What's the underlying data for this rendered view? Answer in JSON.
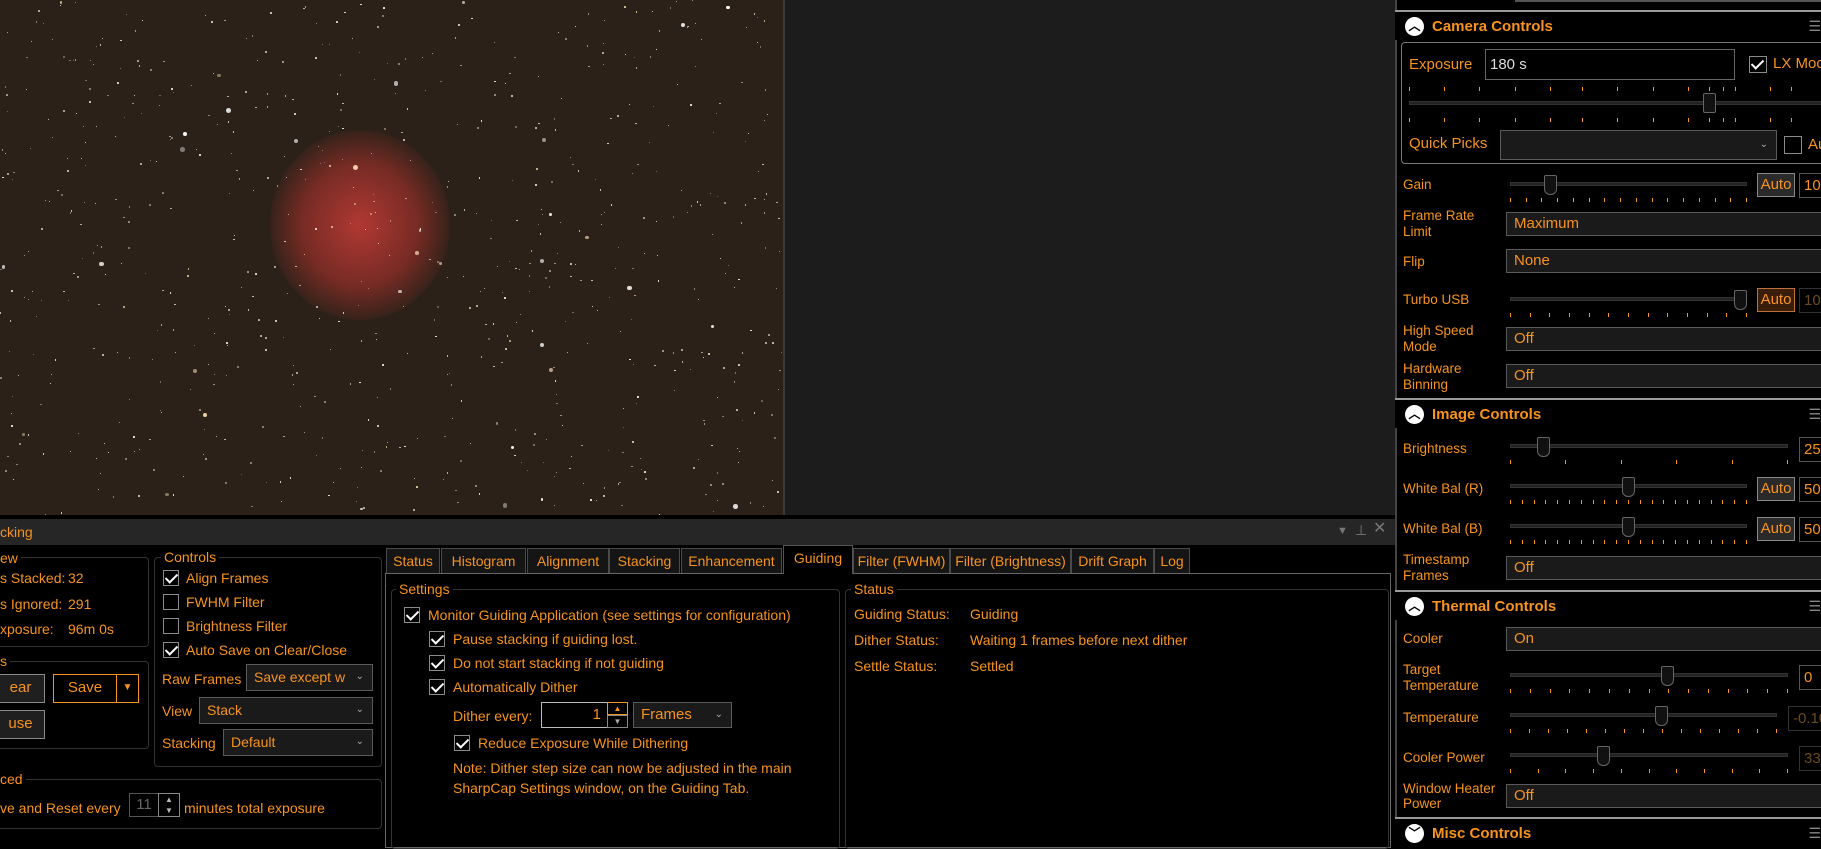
{
  "stacking_panel": {
    "title": "cking",
    "window_icons": [
      "dropdown-icon",
      "pin-icon",
      "close-icon"
    ],
    "overview": {
      "title": "ew",
      "rows": [
        {
          "label": "s Stacked:",
          "value": "32"
        },
        {
          "label": "s Ignored:",
          "value": "291"
        },
        {
          "label": "xposure:",
          "value": "96m 0s"
        }
      ]
    },
    "actions": {
      "title": "s",
      "clear_label": "ear",
      "save_label": "Save",
      "pause_label": "use"
    },
    "controls": {
      "title": "Controls",
      "checks": [
        {
          "label": "Align Frames",
          "checked": true
        },
        {
          "label": "FWHM Filter",
          "checked": false
        },
        {
          "label": "Brightness Filter",
          "checked": false
        },
        {
          "label": "Auto Save on Clear/Close",
          "checked": true
        }
      ],
      "raw_frames_label": "Raw Frames",
      "raw_frames_value": "Save except w",
      "view_label": "View",
      "view_value": "Stack",
      "stacking_label": "Stacking",
      "stacking_value": "Default"
    },
    "advanced": {
      "title": "ced",
      "prefix": "ve and Reset every",
      "value": "11",
      "suffix": "minutes total exposure"
    },
    "tabs": [
      "Status",
      "Histogram",
      "Alignment",
      "Stacking",
      "Enhancement",
      "Guiding",
      "Filter (FWHM)",
      "Filter (Brightness)",
      "Drift Graph",
      "Log"
    ],
    "active_tab": "Guiding",
    "guiding": {
      "settings_title": "Settings",
      "monitor": "Monitor Guiding Application (see settings for configuration)",
      "pause": "Pause stacking if guiding lost.",
      "no_start": "Do not start stacking if not guiding",
      "auto_dither": "Automatically Dither",
      "dither_every_label": "Dither every:",
      "dither_every_value": "1",
      "dither_unit": "Frames",
      "reduce_exposure": "Reduce Exposure While Dithering",
      "note_line1": "Note: Dither step size can now be adjusted in the main",
      "note_line2": "SharpCap Settings window, on the Guiding Tab.",
      "status_title": "Status",
      "status_rows": [
        {
          "label": "Guiding Status:",
          "value": "Guiding"
        },
        {
          "label": "Dither Status:",
          "value": "Waiting 1 frames before next dither"
        },
        {
          "label": "Settle Status:",
          "value": "Settled"
        }
      ]
    }
  },
  "camera_controls": {
    "title": "Camera Controls",
    "exposure_label": "Exposure",
    "exposure_value": "180 s",
    "exposure_slider": 0.86,
    "lx_mode_label": "LX Moc",
    "lx_mode_checked": true,
    "quick_picks_label": "Quick Picks",
    "quick_picks_value": "",
    "auto_partial_label": "Au",
    "gain_label": "Gain",
    "gain_value": "10",
    "gain_slider": 0.15,
    "gain_auto": "Auto",
    "frame_rate_label_1": "Frame Rate",
    "frame_rate_label_2": "Limit",
    "frame_rate_value": "Maximum",
    "flip_label": "Flip",
    "flip_value": "None",
    "turbo_label": "Turbo USB",
    "turbo_value": "10",
    "turbo_slider": 1.0,
    "turbo_auto": "Auto",
    "high_speed_label_1": "High Speed",
    "high_speed_label_2": "Mode",
    "high_speed_value": "Off",
    "binning_label_1": "Hardware",
    "binning_label_2": "Binning",
    "binning_value": "Off"
  },
  "image_controls": {
    "title": "Image Controls",
    "brightness_label": "Brightness",
    "brightness_value": "25",
    "brightness_slider": 0.1,
    "wb_r_label": "White Bal (R)",
    "wb_r_value": "50",
    "wb_r_slider": 0.5,
    "wb_r_auto": "Auto",
    "wb_b_label": "White Bal (B)",
    "wb_b_value": "50",
    "wb_b_slider": 0.5,
    "wb_b_auto": "Auto",
    "timestamp_label_1": "Timestamp",
    "timestamp_label_2": "Frames",
    "timestamp_value": "Off"
  },
  "thermal_controls": {
    "title": "Thermal Controls",
    "cooler_label": "Cooler",
    "cooler_value": "On",
    "target_label_1": "Target",
    "target_label_2": "Temperature",
    "target_value": "0",
    "target_slider": 0.57,
    "temp_label": "Temperature",
    "temp_value": "-0.10",
    "temp_slider": 0.57,
    "power_label": "Cooler Power",
    "power_value": "33",
    "power_slider": 0.33,
    "heater_label_1": "Window Heater",
    "heater_label_2": "Power",
    "heater_value": "Off"
  },
  "misc_controls": {
    "title": "Misc Controls"
  },
  "colors": {
    "accent": "#f7931e",
    "panel": "#000000",
    "titlebar": "#262626"
  }
}
